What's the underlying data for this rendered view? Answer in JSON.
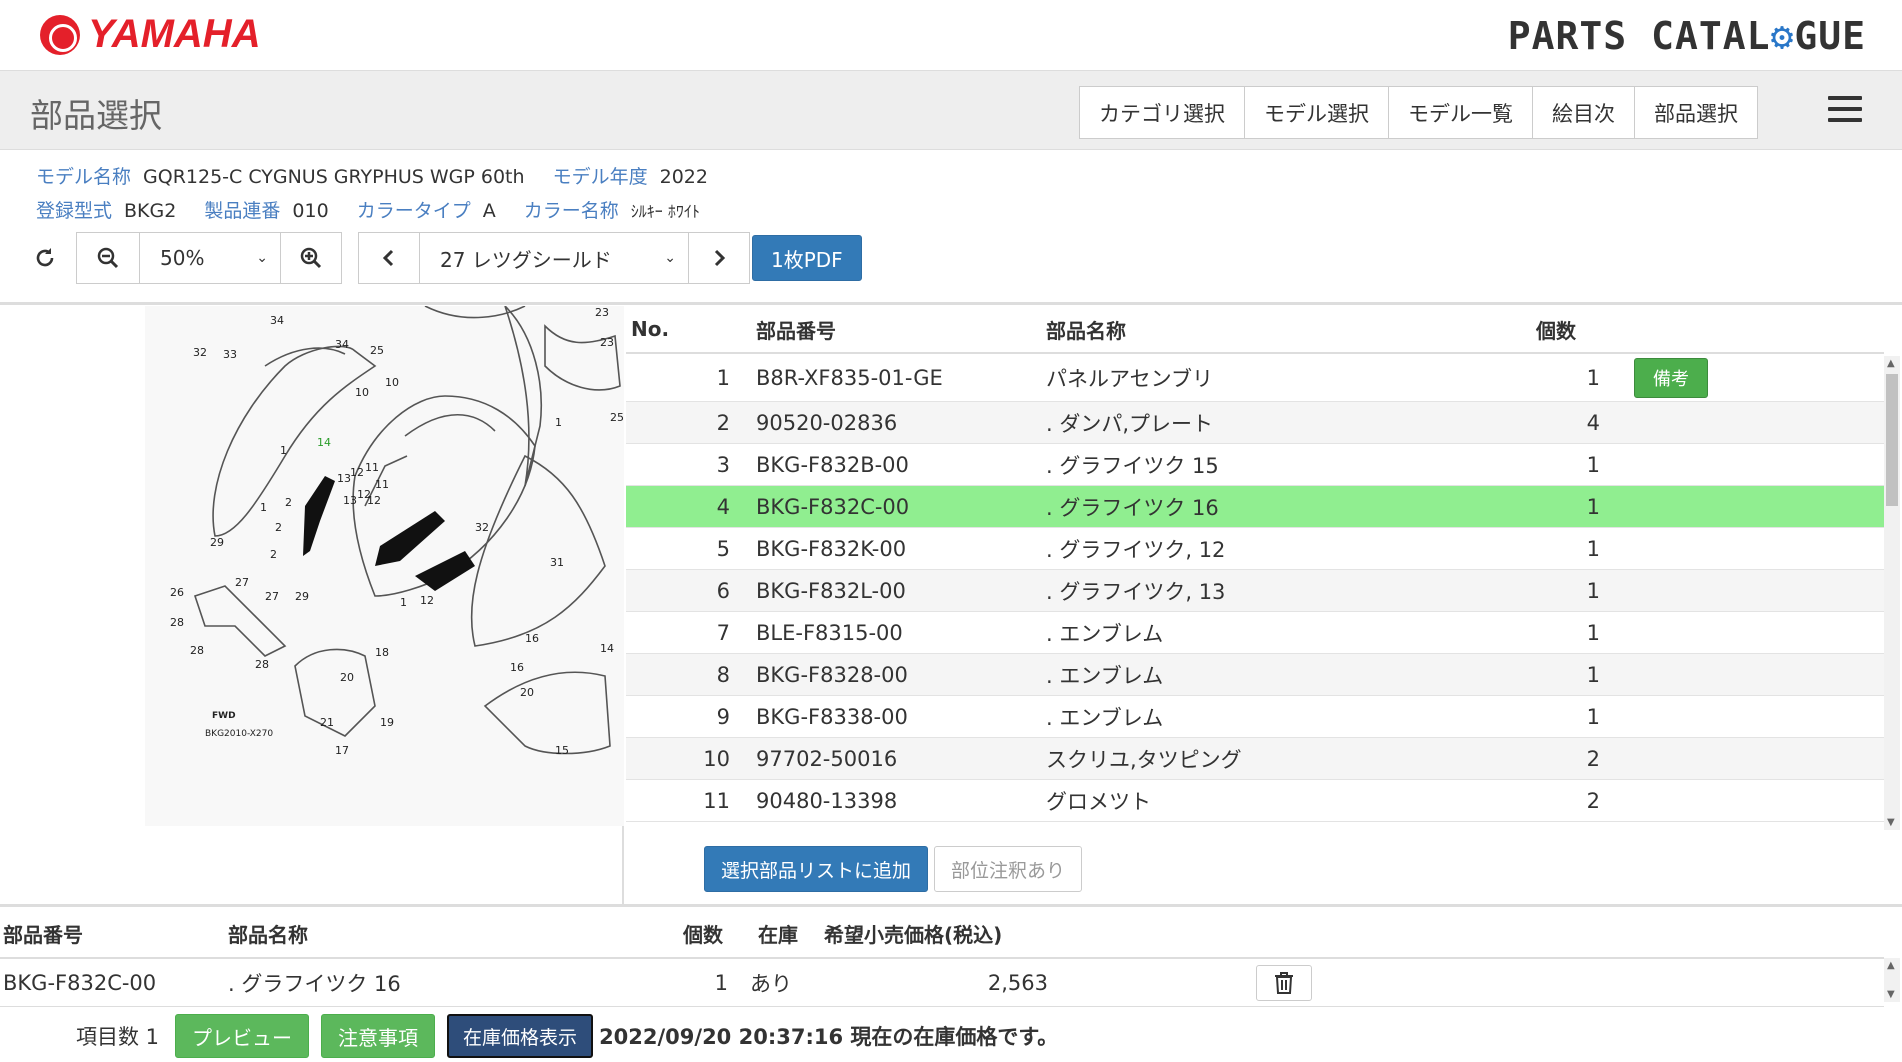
{
  "brand": {
    "logo": "YAMAHA",
    "catalogue_prefix": "PARTS CATAL",
    "catalogue_suffix": "GUE"
  },
  "page_title": "部品選択",
  "nav": [
    "カテゴリ選択",
    "モデル選択",
    "モデル一覧",
    "絵目次",
    "部品選択"
  ],
  "model": {
    "name_label": "モデル名称",
    "name": "GQR125-C CYGNUS GRYPHUS WGP 60th",
    "year_label": "モデル年度",
    "year": "2022",
    "type_label": "登録型式",
    "type": "BKG2",
    "serial_label": "製品連番",
    "serial": "010",
    "color_type_label": "カラータイプ",
    "color_type": "A",
    "color_name_label": "カラー名称",
    "color_name": "ｼﾙｷｰ ﾎﾜｲﾄ"
  },
  "toolbar": {
    "zoom": "50%",
    "figure": "27 レツグシールド",
    "pdf": "1枚PDF"
  },
  "parts_header": {
    "no": "No.",
    "part_no": "部品番号",
    "name": "部品名称",
    "qty": "個数"
  },
  "parts": [
    {
      "no": "1",
      "part_no": "B8R-XF835-01-GE",
      "name": "パネルアセンブリ",
      "qty": "1",
      "remark": "備考"
    },
    {
      "no": "2",
      "part_no": "90520-02836",
      "name": ". ダンパ,プレート",
      "qty": "4",
      "remark": ""
    },
    {
      "no": "3",
      "part_no": "BKG-F832B-00",
      "name": ". グラフイツク 15",
      "qty": "1",
      "remark": ""
    },
    {
      "no": "4",
      "part_no": "BKG-F832C-00",
      "name": ". グラフイツク 16",
      "qty": "1",
      "remark": ""
    },
    {
      "no": "5",
      "part_no": "BKG-F832K-00",
      "name": ". グラフイツク, 12",
      "qty": "1",
      "remark": ""
    },
    {
      "no": "6",
      "part_no": "BKG-F832L-00",
      "name": ". グラフイツク, 13",
      "qty": "1",
      "remark": ""
    },
    {
      "no": "7",
      "part_no": "BLE-F8315-00",
      "name": ". エンブレム",
      "qty": "1",
      "remark": ""
    },
    {
      "no": "8",
      "part_no": "BKG-F8328-00",
      "name": ". エンブレム",
      "qty": "1",
      "remark": ""
    },
    {
      "no": "9",
      "part_no": "BKG-F8338-00",
      "name": ". エンブレム",
      "qty": "1",
      "remark": ""
    },
    {
      "no": "10",
      "part_no": "97702-50016",
      "name": "スクリユ,タツピング",
      "qty": "2",
      "remark": ""
    },
    {
      "no": "11",
      "part_no": "90480-13398",
      "name": "グロメツト",
      "qty": "2",
      "remark": ""
    }
  ],
  "selected_row": "4",
  "actions": {
    "add": "選択部品リストに追加",
    "note": "部位注釈あり"
  },
  "selected_header": {
    "part_no": "部品番号",
    "name": "部品名称",
    "qty": "個数",
    "stock": "在庫",
    "price": "希望小売価格(税込)"
  },
  "selected": [
    {
      "part_no": "BKG-F832C-00",
      "name": ". グラフイツク 16",
      "qty": "1",
      "stock": "あり",
      "price": "2,563"
    }
  ],
  "footer": {
    "count_label": "項目数 1",
    "preview": "プレビュー",
    "notes": "注意事項",
    "stock_price": "在庫価格表示",
    "stamp": "2022/09/20 20:37:16 現在の在庫価格です。"
  },
  "diagram": {
    "code": "BKG2010-X270",
    "fwd": "FWD",
    "callouts": [
      "34",
      "32",
      "33",
      "34",
      "25",
      "23",
      "23",
      "10",
      "10",
      "25",
      "1",
      "14",
      "1",
      "13",
      "12",
      "11",
      "12",
      "13",
      "12",
      "11",
      "2",
      "2",
      "1",
      "2",
      "32",
      "27",
      "29",
      "26",
      "27",
      "29",
      "28",
      "28",
      "28",
      "1",
      "12",
      "31",
      "16",
      "18",
      "20",
      "16",
      "14",
      "21",
      "19",
      "20",
      "17",
      "15"
    ]
  },
  "colors": {
    "accent_blue": "#337ab7",
    "highlight": "#90ee90",
    "brand_red": "#e4202a",
    "green": "#5cb85c"
  }
}
